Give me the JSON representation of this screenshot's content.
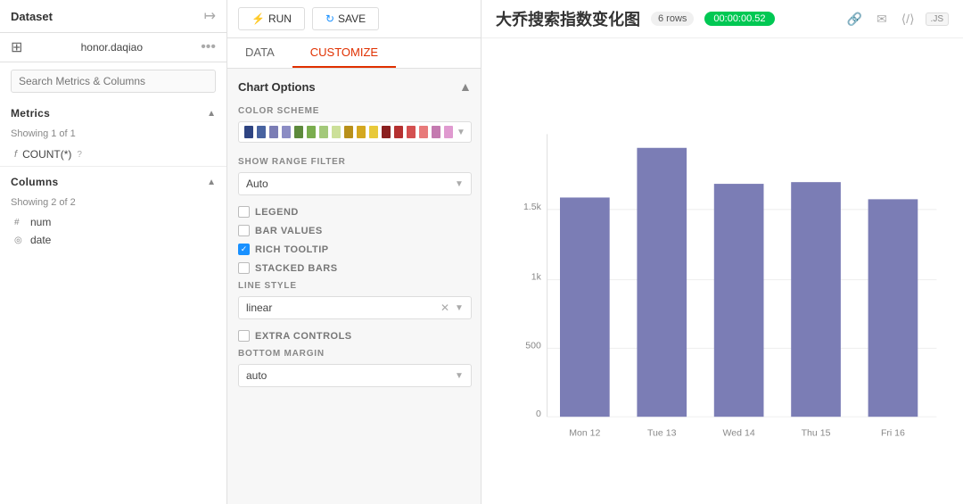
{
  "left": {
    "dataset_label": "Dataset",
    "dataset_name": "honor.daqiao",
    "search_placeholder": "Search Metrics & Columns",
    "metrics_label": "Metrics",
    "metrics_showing": "Showing 1 of 1",
    "metrics": [
      {
        "icon": "f",
        "label": "COUNT(*)",
        "has_help": true
      }
    ],
    "columns_label": "Columns",
    "columns_showing": "Showing 2 of 2",
    "columns": [
      {
        "type": "#",
        "label": "num"
      },
      {
        "type": "◎",
        "label": "date"
      }
    ]
  },
  "middle": {
    "btn_run": "RUN",
    "btn_save": "SAVE",
    "tab_data": "DATA",
    "tab_customize": "CUSTOMIZE",
    "options_header": "Chart Options",
    "color_scheme_label": "COLOR SCHEME",
    "color_swatches": [
      "#2e4482",
      "#4863a0",
      "#6b6fa8",
      "#8b8cc4",
      "#5d8a3c",
      "#7aad4e",
      "#a3c97a",
      "#cce099",
      "#b8901a",
      "#d4a820",
      "#e8c93a",
      "#f0e060",
      "#8b2020",
      "#b53030",
      "#d45050",
      "#e87a7a",
      "#c47ab0",
      "#e09ad0"
    ],
    "show_range_filter_label": "SHOW RANGE FILTER",
    "show_range_filter_value": "Auto",
    "legend_label": "LEGEND",
    "legend_checked": false,
    "bar_values_label": "BAR VALUES",
    "bar_values_checked": false,
    "rich_tooltip_label": "RICH TOOLTIP",
    "rich_tooltip_checked": true,
    "stacked_bars_label": "STACKED BARS",
    "stacked_bars_checked": false,
    "line_style_label": "LINE STYLE",
    "line_style_value": "linear",
    "extra_controls_label": "EXTRA CONTROLS",
    "extra_controls_checked": false,
    "bottom_margin_label": "BOTTOM MARGIN",
    "bottom_margin_value": "auto"
  },
  "chart": {
    "title": "大乔搜索指数变化图",
    "rows_label": "6 rows",
    "time_label": "00:00:00.52",
    "y_labels": [
      "0",
      "500",
      "1k",
      "1.5k"
    ],
    "x_labels": [
      "Mon 12",
      "Tue 13",
      "Wed 14",
      "Thu 15",
      "Fri 16"
    ],
    "bars": [
      {
        "label": "Mon 12",
        "value": 1550
      },
      {
        "label": "Tue 13",
        "value": 1900
      },
      {
        "label": "Wed 14",
        "value": 1650
      },
      {
        "label": "Thu 15",
        "value": 1660
      },
      {
        "label": "Fri 16",
        "value": 1540
      }
    ],
    "max_value": 2000,
    "icons": [
      "link",
      "mail",
      "code",
      "js"
    ]
  }
}
